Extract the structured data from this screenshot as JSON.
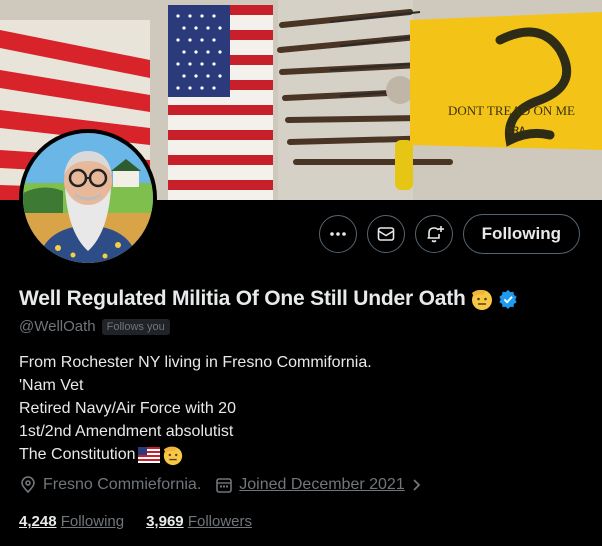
{
  "profile": {
    "display_name": "Well Regulated Militia Of One Still Under Oath",
    "handle": "@WellOath",
    "follows_you_badge": "Follows you",
    "verified": true,
    "bio_lines": [
      "From Rochester NY living in Fresno Commifornia.",
      "'Nam Vet",
      "Retired Navy/Air Force with 20",
      "1st/2nd Amendment absolutist",
      "The Constitution"
    ],
    "location": "Fresno Commiefornia.",
    "joined": "Joined December 2021",
    "following_count": "4,248",
    "following_label": "Following",
    "followers_count": "3,969",
    "followers_label": "Followers"
  },
  "actions": {
    "more_label": "More",
    "message_label": "Message",
    "notify_label": "Notifications",
    "follow_button_label": "Following"
  },
  "banner": {
    "flag_text": "DONT TREAD ON ME",
    "flag_subtext": "NRA"
  },
  "colors": {
    "background": "#000000",
    "text_primary": "#e7e9ea",
    "text_secondary": "#71767b",
    "border": "#536471",
    "verified_blue": "#1d9bf0",
    "gadsden_yellow": "#f3c417"
  },
  "icons": [
    "more-icon",
    "mail-icon",
    "bell-plus-icon",
    "verified-icon",
    "location-icon",
    "calendar-icon",
    "chevron-right-icon"
  ]
}
